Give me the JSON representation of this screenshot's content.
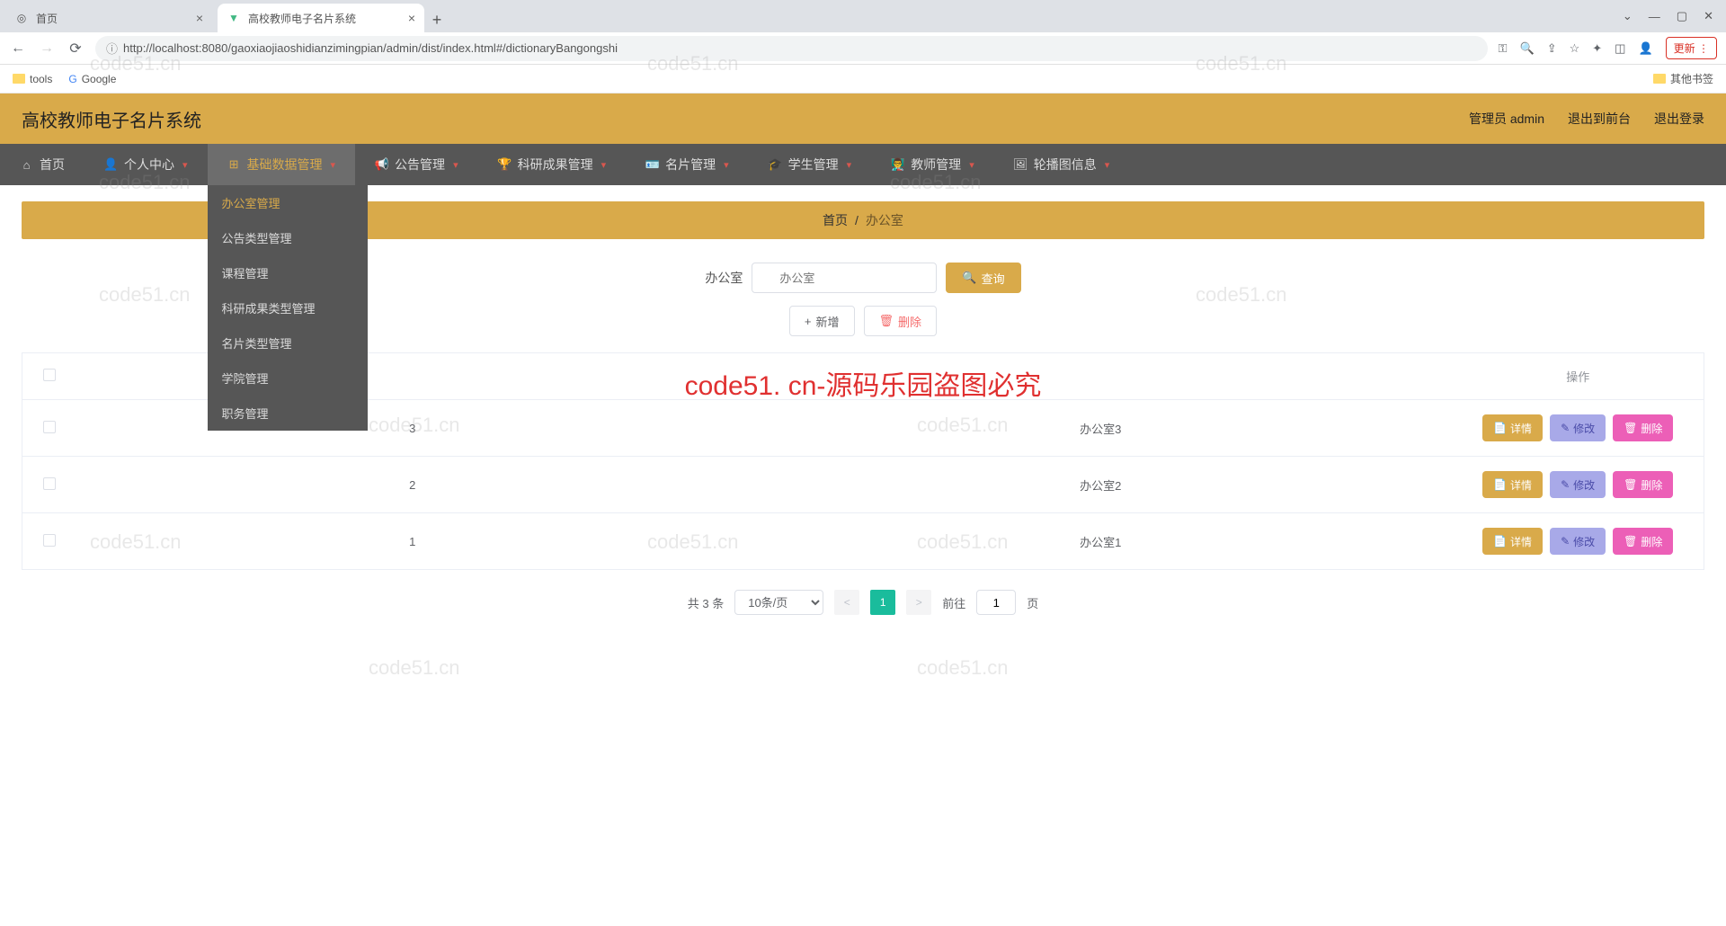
{
  "browser": {
    "tabs": [
      {
        "title": "首页",
        "active": false
      },
      {
        "title": "高校教师电子名片系统",
        "active": true
      }
    ],
    "url": "http://localhost:8080/gaoxiaojiaoshidianzimingpian/admin/dist/index.html#/dictionaryBangongshi",
    "update_btn": "更新",
    "bookmarks": {
      "tools": "tools",
      "google": "Google",
      "other": "其他书签"
    }
  },
  "header": {
    "title": "高校教师电子名片系统",
    "user": "管理员 admin",
    "exit_front": "退出到前台",
    "logout": "退出登录"
  },
  "nav": {
    "items": [
      {
        "label": "首页",
        "chev": false
      },
      {
        "label": "个人中心",
        "chev": true
      },
      {
        "label": "基础数据管理",
        "chev": true,
        "active": true
      },
      {
        "label": "公告管理",
        "chev": true
      },
      {
        "label": "科研成果管理",
        "chev": true
      },
      {
        "label": "名片管理",
        "chev": true
      },
      {
        "label": "学生管理",
        "chev": true
      },
      {
        "label": "教师管理",
        "chev": true
      },
      {
        "label": "轮播图信息",
        "chev": true
      }
    ],
    "dropdown": [
      {
        "label": "办公室管理",
        "active": true
      },
      {
        "label": "公告类型管理"
      },
      {
        "label": "课程管理"
      },
      {
        "label": "科研成果类型管理"
      },
      {
        "label": "名片类型管理"
      },
      {
        "label": "学院管理"
      },
      {
        "label": "职务管理"
      }
    ]
  },
  "breadcrumb": {
    "home": "首页",
    "current": "办公室"
  },
  "search": {
    "label": "办公室",
    "placeholder": "办公室",
    "query_btn": "查询"
  },
  "actions": {
    "add": "新增",
    "delete": "删除"
  },
  "table": {
    "col_ops": "操作",
    "rows": [
      {
        "id": "3",
        "name": "办公室3"
      },
      {
        "id": "2",
        "name": "办公室2"
      },
      {
        "id": "1",
        "name": "办公室1"
      }
    ],
    "btn_detail": "详情",
    "btn_edit": "修改",
    "btn_delete": "删除"
  },
  "pagination": {
    "total": "共 3 条",
    "pagesize": "10条/页",
    "current": "1",
    "goto_pre": "前往",
    "goto_val": "1",
    "goto_post": "页"
  },
  "watermark_text": "code51.cn",
  "red_banner": "code51. cn-源码乐园盗图必究"
}
